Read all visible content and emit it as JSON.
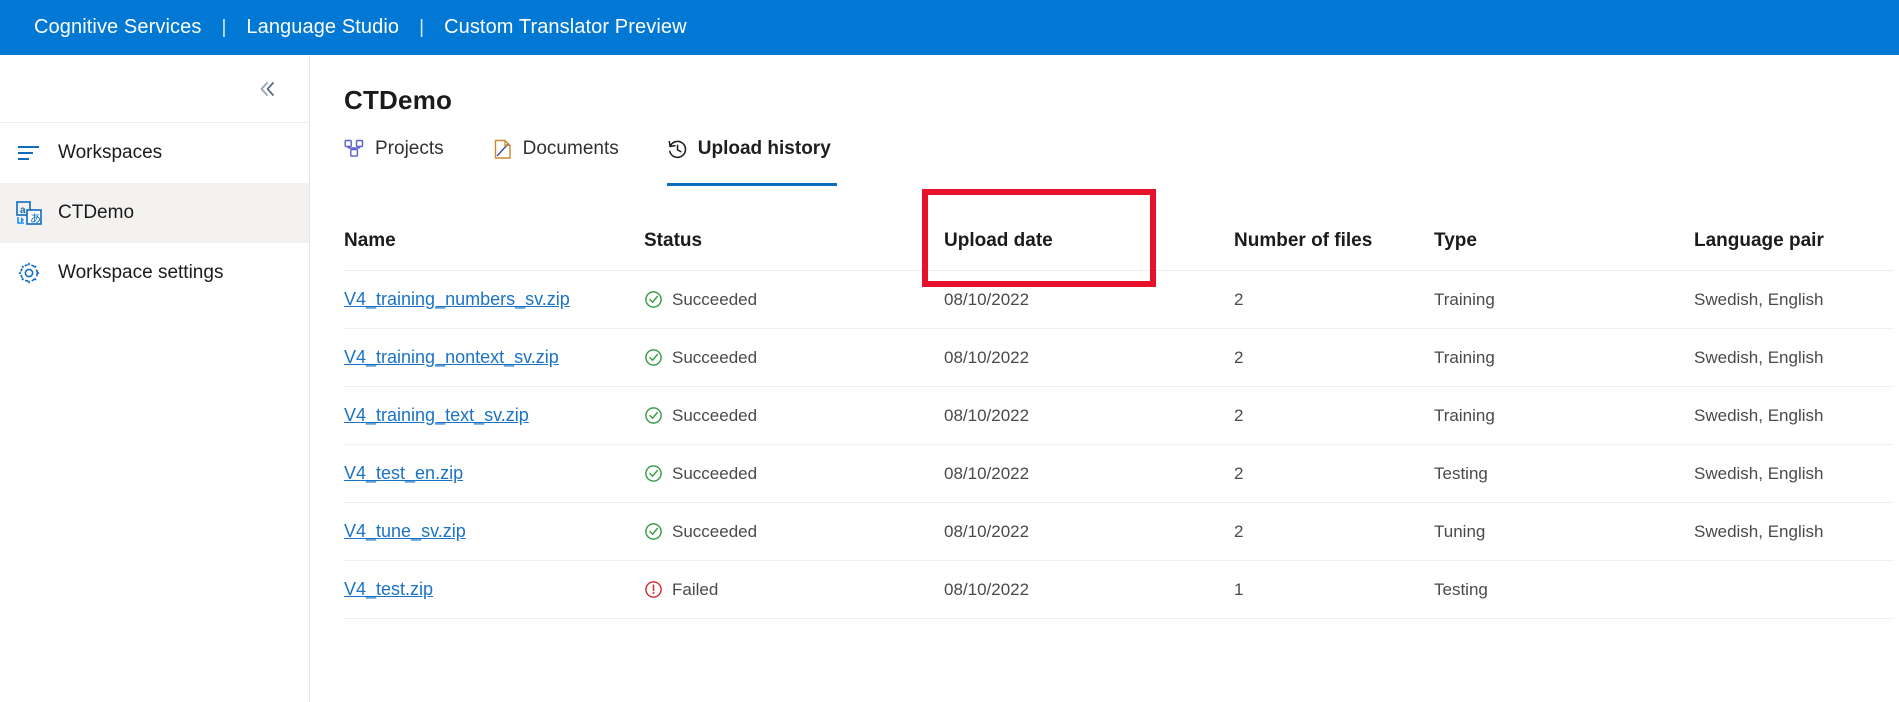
{
  "topbar": {
    "links": [
      "Cognitive Services",
      "Language Studio",
      "Custom Translator Preview"
    ],
    "separator": "|",
    "background": "#0078d4"
  },
  "sidebar": {
    "collapse_icon": "double-chevron-left-icon",
    "items": [
      {
        "label": "Workspaces",
        "icon": "list-icon",
        "active": false
      },
      {
        "label": "CTDemo",
        "icon": "translator-icon",
        "active": true
      },
      {
        "label": "Workspace settings",
        "icon": "gear-icon",
        "active": false
      }
    ]
  },
  "main": {
    "page_title": "CTDemo",
    "tabs": [
      {
        "label": "Projects",
        "icon": "projects-icon",
        "active": false
      },
      {
        "label": "Documents",
        "icon": "document-icon",
        "active": false
      },
      {
        "label": "Upload history",
        "icon": "history-clock-icon",
        "active": true
      }
    ],
    "annotation": {
      "color": "#e8112d",
      "target": "Upload history"
    },
    "accent_color": "#0f6cbd"
  },
  "table": {
    "headers": [
      "Name",
      "Status",
      "Upload date",
      "Number of files",
      "Type",
      "Language pair"
    ],
    "rows": [
      {
        "name": "V4_training_numbers_sv.zip",
        "status": "Succeeded",
        "status_icon": "check-circle-icon",
        "status_color": "#3f9e4d",
        "upload_date": "08/10/2022",
        "number_of_files": "2",
        "type": "Training",
        "language_pair": "Swedish, English"
      },
      {
        "name": "V4_training_nontext_sv.zip",
        "status": "Succeeded",
        "status_icon": "check-circle-icon",
        "status_color": "#3f9e4d",
        "upload_date": "08/10/2022",
        "number_of_files": "2",
        "type": "Training",
        "language_pair": "Swedish, English"
      },
      {
        "name": "V4_training_text_sv.zip",
        "status": "Succeeded",
        "status_icon": "check-circle-icon",
        "status_color": "#3f9e4d",
        "upload_date": "08/10/2022",
        "number_of_files": "2",
        "type": "Training",
        "language_pair": "Swedish, English"
      },
      {
        "name": "V4_test_en.zip",
        "status": "Succeeded",
        "status_icon": "check-circle-icon",
        "status_color": "#3f9e4d",
        "upload_date": "08/10/2022",
        "number_of_files": "2",
        "type": "Testing",
        "language_pair": "Swedish, English"
      },
      {
        "name": "V4_tune_sv.zip",
        "status": "Succeeded",
        "status_icon": "check-circle-icon",
        "status_color": "#3f9e4d",
        "upload_date": "08/10/2022",
        "number_of_files": "2",
        "type": "Tuning",
        "language_pair": "Swedish, English"
      },
      {
        "name": "V4_test.zip",
        "status": "Failed",
        "status_icon": "error-circle-icon",
        "status_color": "#d13438",
        "upload_date": "08/10/2022",
        "number_of_files": "1",
        "type": "Testing",
        "language_pair": ""
      }
    ]
  }
}
